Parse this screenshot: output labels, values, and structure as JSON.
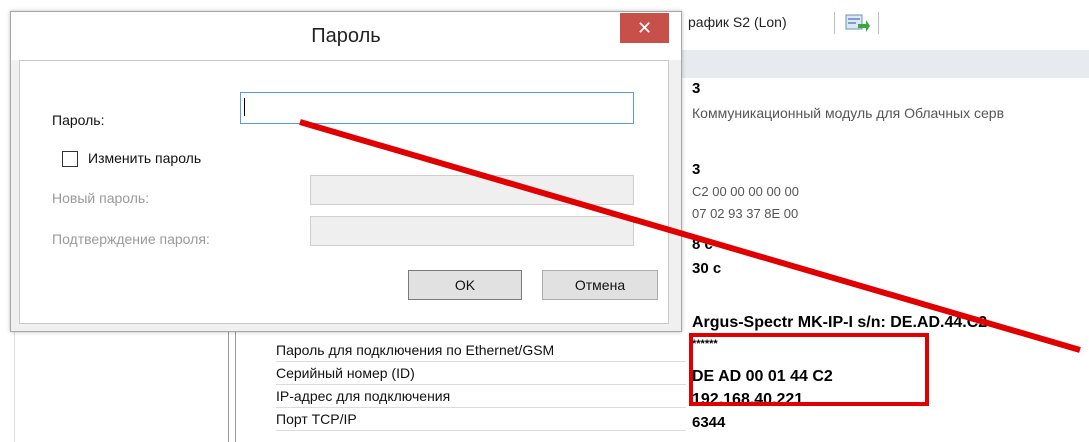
{
  "background_app": {
    "toolbar_tab": "рафик S2 (Lon)",
    "values": [
      "3",
      "Коммуникационный модуль для Облачных серв",
      "3",
      "C2 00 00 00 00 00",
      "07 02 93 37 8E 00",
      "8 с",
      "30 с",
      "Argus-Spectr MK-IP-I s/n: DE.AD.44.C2",
      "******",
      "DE AD 00 01 44 C2",
      "192.168.40.221",
      "6344"
    ],
    "property_names": [
      "Пароль для подключения по Ethernet/GSM",
      "Серийный номер (ID)",
      "IP-адрес для подключения",
      "Порт TCP/IP"
    ]
  },
  "dialog": {
    "title": "Пароль",
    "close_glyph": "✕",
    "password_label": "Пароль:",
    "password_value": "",
    "change_password_label": "Изменить пароль",
    "change_password_checked": false,
    "new_password_label": "Новый пароль:",
    "confirm_password_label": "Подтверждение пароля:",
    "ok_label": "OK",
    "cancel_label": "Отмена"
  },
  "colors": {
    "close_button": "#c7504b",
    "annotation_red": "#e00000"
  }
}
